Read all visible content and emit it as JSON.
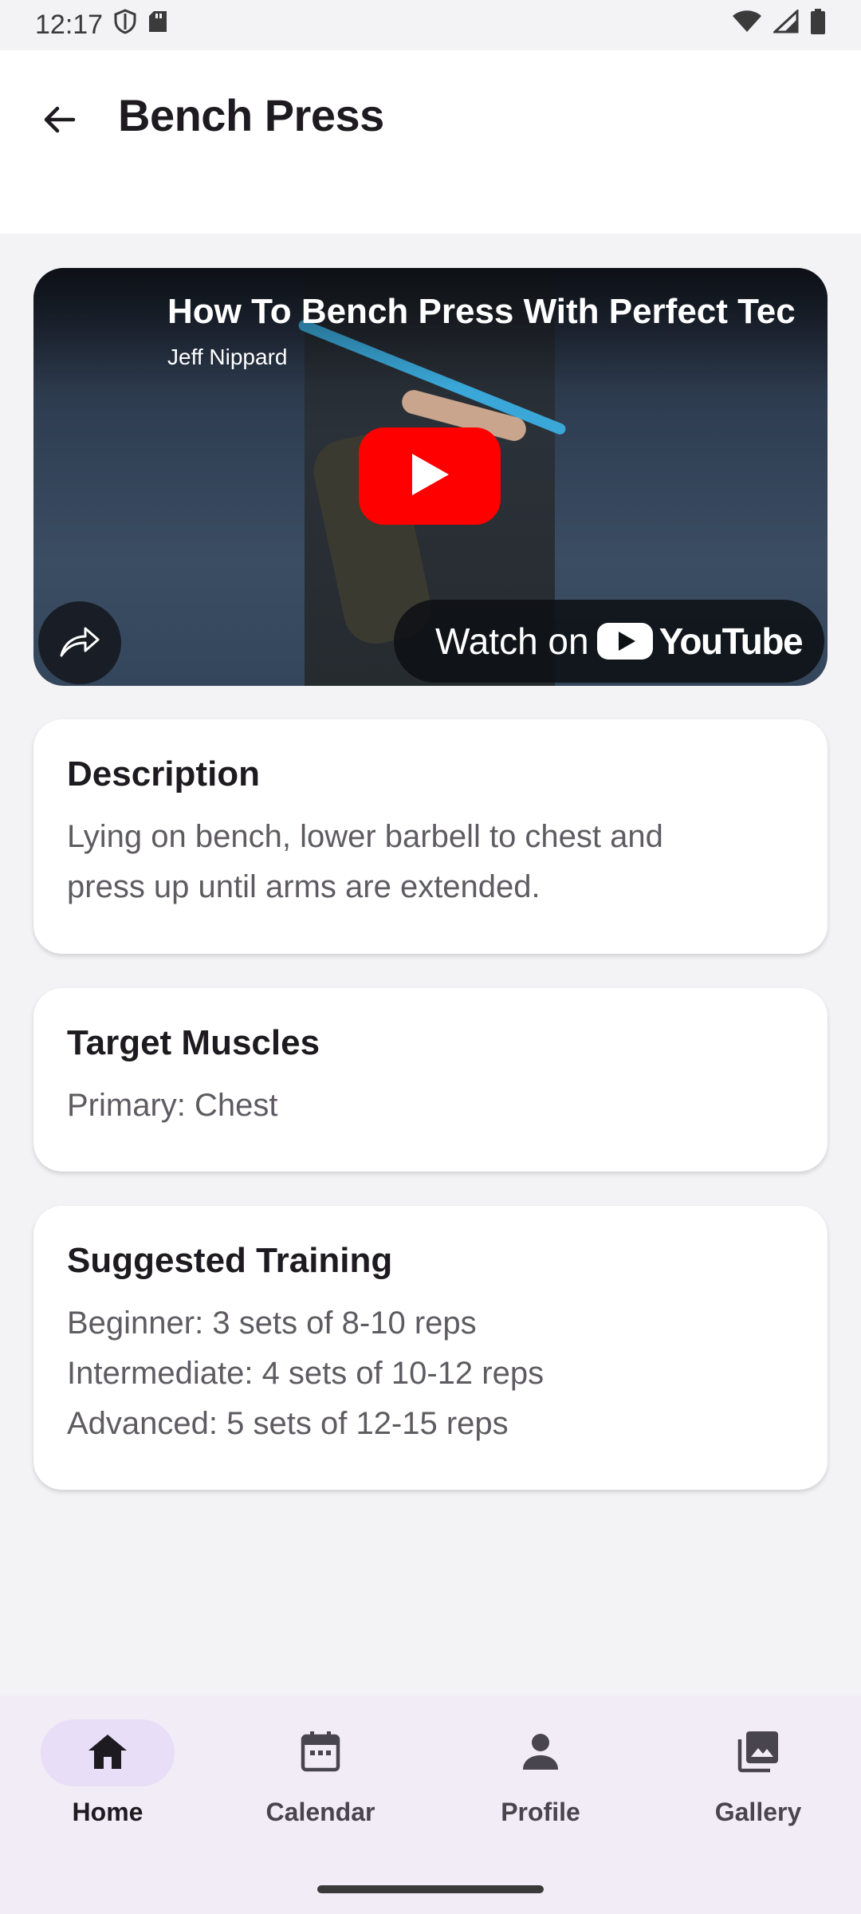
{
  "status_bar": {
    "time": "12:17"
  },
  "header": {
    "title": "Bench Press",
    "back_icon": "arrow-back-icon"
  },
  "video": {
    "title": "How To Bench Press With Perfect Tec",
    "channel": "Jeff Nippard",
    "watch_label": "Watch on",
    "youtube_label": "YouTube",
    "colors": {
      "play": "#ff0000"
    }
  },
  "description": {
    "title": "Description",
    "lines": [
      "Lying on bench, lower barbell to chest and",
      "press up until arms are extended."
    ]
  },
  "target_muscles": {
    "title": "Target Muscles",
    "lines": [
      "Primary: Chest"
    ]
  },
  "suggested_training": {
    "title": "Suggested Training",
    "lines": [
      "Beginner: 3 sets of 8-10 reps",
      "Intermediate: 4 sets of 10-12 reps",
      "Advanced: 5 sets of 12-15 reps"
    ]
  },
  "bottom_nav": {
    "items": [
      {
        "label": "Home",
        "icon": "home-icon",
        "active": true
      },
      {
        "label": "Calendar",
        "icon": "calendar-icon",
        "active": false
      },
      {
        "label": "Profile",
        "icon": "person-icon",
        "active": false
      },
      {
        "label": "Gallery",
        "icon": "gallery-icon",
        "active": false
      }
    ],
    "active_color": "#e8def8"
  }
}
